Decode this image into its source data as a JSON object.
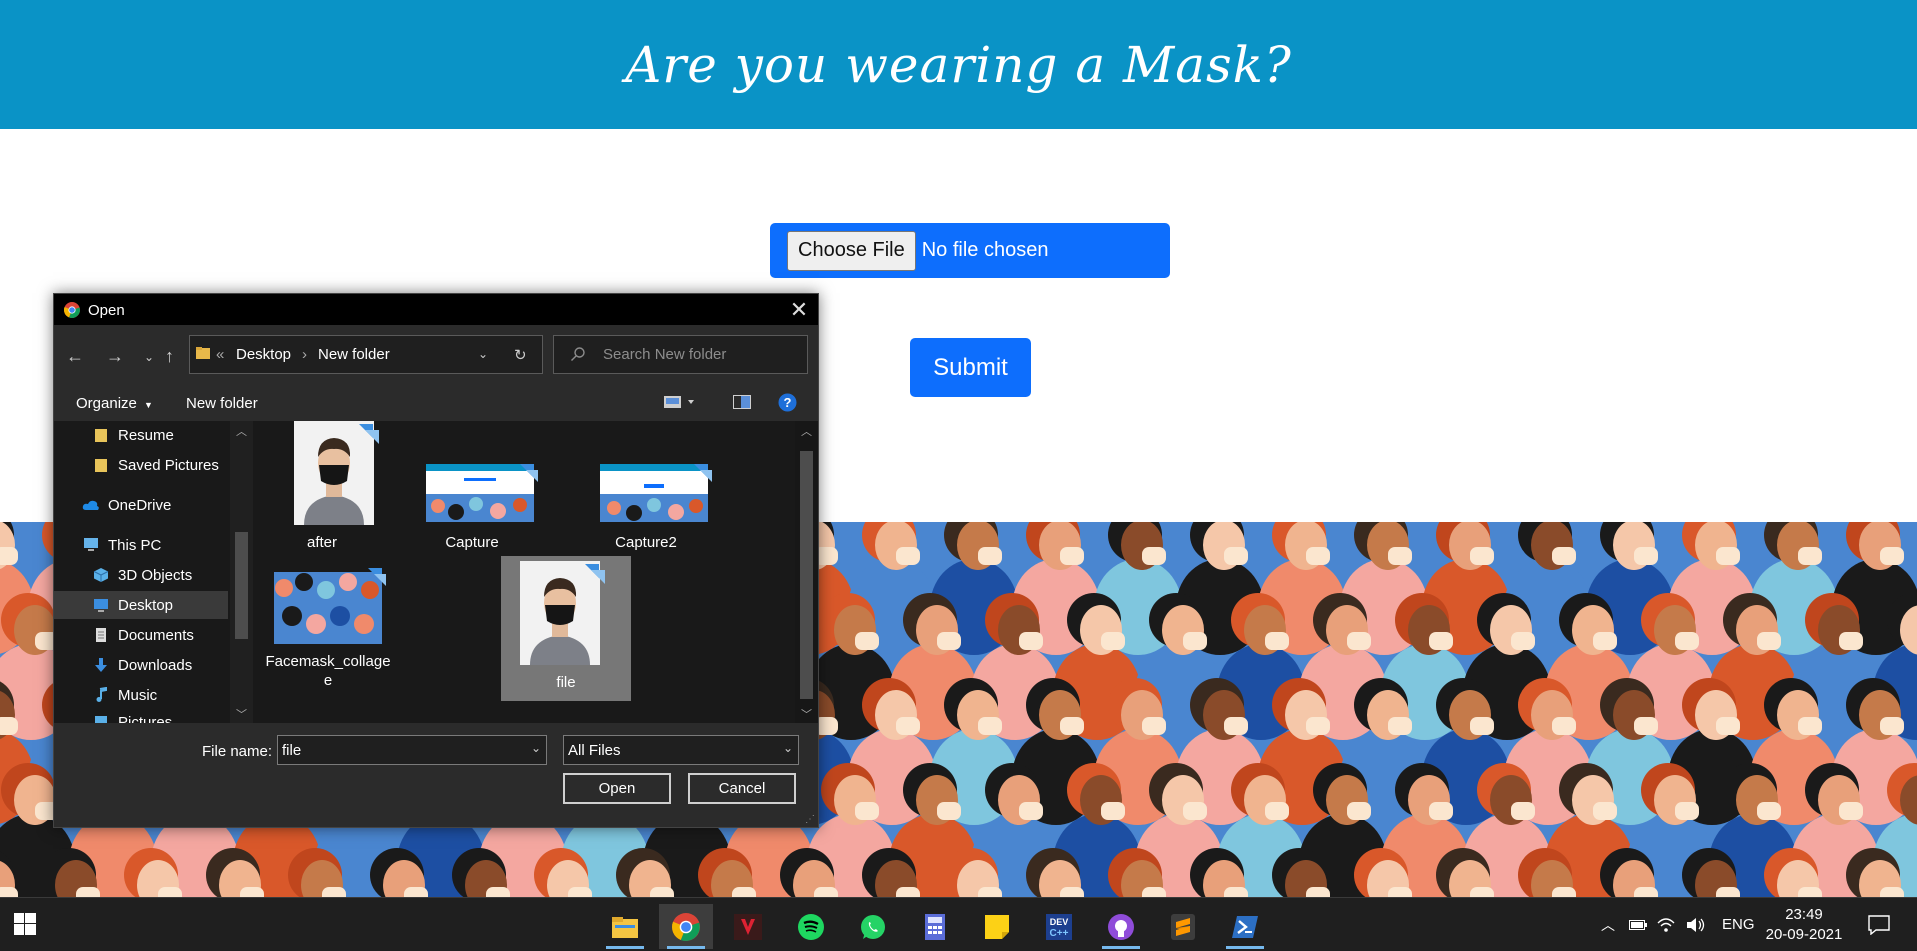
{
  "page": {
    "title": "Are you wearing a Mask?",
    "choose_file_label": "Choose File",
    "no_file_text": "No file chosen",
    "submit_label": "Submit",
    "header_color": "#0a93c6",
    "accent_color": "#0d6efd"
  },
  "dialog": {
    "title": "Open",
    "app_icon": "chrome-icon",
    "breadcrumb": [
      "Desktop",
      "New folder"
    ],
    "breadcrumb_prefix": "«",
    "search_placeholder": "Search New folder",
    "toolbar": {
      "organize": "Organize",
      "new_folder": "New folder"
    },
    "nav_items": [
      {
        "label": "Resume",
        "icon": "folder-icon"
      },
      {
        "label": "Saved Pictures",
        "icon": "folder-icon"
      },
      {
        "label": "OneDrive",
        "icon": "cloud-icon"
      },
      {
        "label": "This PC",
        "icon": "computer-icon"
      },
      {
        "label": "3D Objects",
        "icon": "cube-icon"
      },
      {
        "label": "Desktop",
        "icon": "desktop-icon",
        "selected": true
      },
      {
        "label": "Documents",
        "icon": "document-icon"
      },
      {
        "label": "Downloads",
        "icon": "download-icon"
      },
      {
        "label": "Music",
        "icon": "music-icon"
      },
      {
        "label": "Pictures",
        "icon": "pictures-icon"
      }
    ],
    "files": [
      {
        "name": "after",
        "type": "portrait"
      },
      {
        "name": "Capture",
        "type": "screenshot"
      },
      {
        "name": "Capture2",
        "type": "screenshot"
      },
      {
        "name": "Facemask_collage",
        "name_line2": "e",
        "type": "collage"
      },
      {
        "name": "file",
        "type": "portrait",
        "selected": true
      }
    ],
    "file_name_label": "File name:",
    "file_name_value": "file",
    "file_type_value": "All Files",
    "open_label": "Open",
    "cancel_label": "Cancel"
  },
  "taskbar": {
    "apps": [
      "file-explorer-icon",
      "chrome-icon",
      "predator-icon",
      "spotify-icon",
      "whatsapp-icon",
      "calculator-icon",
      "sticky-notes-icon",
      "devc-icon",
      "github-desktop-icon",
      "sublime-text-icon",
      "powershell-icon"
    ],
    "language": "ENG",
    "time": "23:49",
    "date": "20-09-2021"
  }
}
